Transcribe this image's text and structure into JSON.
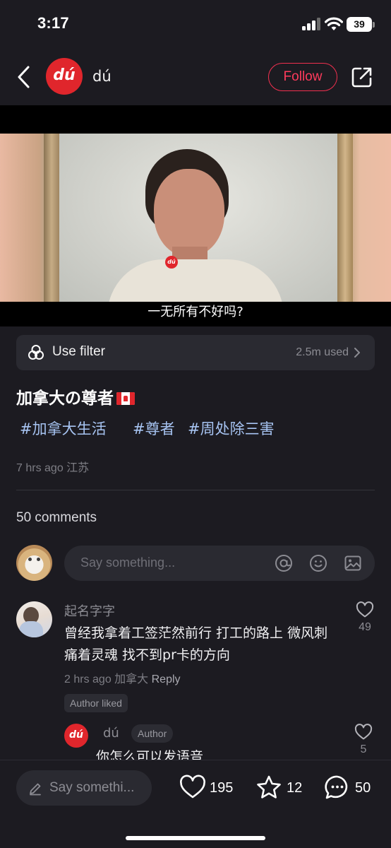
{
  "status_bar": {
    "time": "3:17",
    "battery": "39"
  },
  "header": {
    "logo_text": "dú",
    "author": "dú",
    "follow_label": "Follow"
  },
  "video": {
    "watermark": "dú",
    "subtitle": "一无所有不好吗?"
  },
  "filter": {
    "label": "Use filter",
    "used": "2.5m used"
  },
  "post": {
    "title": "加拿大の尊者",
    "flag": "canada-flag-icon",
    "tags": [
      "#加拿大生活",
      "#尊者",
      "#周处除三害"
    ],
    "meta": "7 hrs ago 江苏"
  },
  "comments": {
    "count_label": "50 comments",
    "input_placeholder": "Say something...",
    "items": [
      {
        "user": "起名字字",
        "text": "曾经我拿着工签茫然前行 打工的路上 微风刺痛着灵魂 找不到pr卡的方向",
        "time_place": "2 hrs ago 加拿大",
        "reply_label": "Reply",
        "badge": "Author liked",
        "likes": "49",
        "replies": [
          {
            "avatar_text": "dú",
            "user": "dú",
            "badge": "Author",
            "text": "你怎么可以发语音",
            "likes": "5"
          }
        ]
      }
    ]
  },
  "bottom_bar": {
    "input_placeholder": "Say somethi...",
    "likes": "195",
    "stars": "12",
    "comments": "50"
  },
  "colors": {
    "background": "#1c1b21",
    "surface": "#2a2a31",
    "accent": "#ff3b5c",
    "tag": "#a7c4f2",
    "brand_red": "#e0262c"
  }
}
